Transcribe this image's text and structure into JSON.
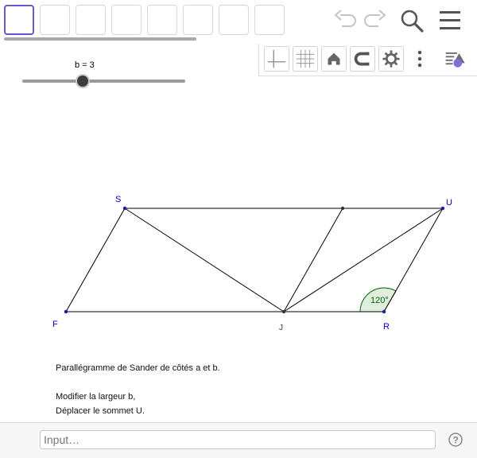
{
  "toolbar": {
    "tools": [
      "tool-1",
      "tool-2",
      "tool-3",
      "tool-4",
      "tool-5",
      "tool-6",
      "tool-7",
      "tool-8"
    ],
    "icons": [
      "undo-icon",
      "redo-icon",
      "search-icon",
      "menu-icon"
    ]
  },
  "stylebar": {
    "icons": [
      "axes-icon",
      "grid-icon",
      "home-icon",
      "magnet-icon",
      "gear-icon",
      "more-vertical-icon",
      "style-bar-icon"
    ]
  },
  "slider": {
    "label": "b = 3",
    "value": 3
  },
  "figure": {
    "points": {
      "S": "S",
      "U": "U",
      "F": "F",
      "J": "J",
      "R": "R"
    },
    "angle_label": "120°"
  },
  "description": {
    "line1": "Parallégramme de Sander de côtés a et b.",
    "line2": "Modifier la largeur b,",
    "line3": "Déplacer le sommet U."
  },
  "input": {
    "placeholder": "Input…",
    "value": ""
  },
  "colors": {
    "accent": "#6557d2",
    "point_label": "#0000cc",
    "angle_fill": "#dfeedd",
    "angle_stroke": "#006400"
  }
}
